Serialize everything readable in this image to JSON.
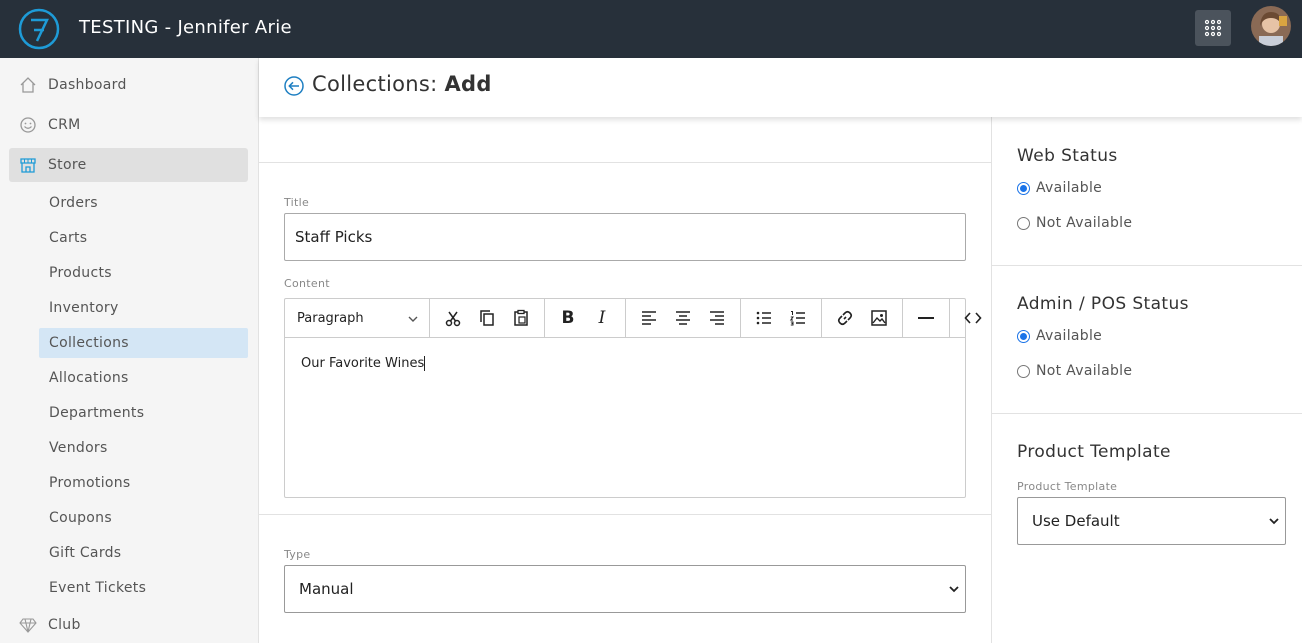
{
  "app": {
    "title": "TESTING - Jennifer Arie"
  },
  "sidebar": {
    "top_items": [
      {
        "label": "Dashboard",
        "icon": "home-icon"
      },
      {
        "label": "CRM",
        "icon": "smiley-icon"
      },
      {
        "label": "Store",
        "icon": "store-icon",
        "active": true
      }
    ],
    "store_items": [
      {
        "label": "Orders"
      },
      {
        "label": "Carts"
      },
      {
        "label": "Products"
      },
      {
        "label": "Inventory"
      },
      {
        "label": "Collections",
        "active": true
      },
      {
        "label": "Allocations"
      },
      {
        "label": "Departments"
      },
      {
        "label": "Vendors"
      },
      {
        "label": "Promotions"
      },
      {
        "label": "Coupons"
      },
      {
        "label": "Gift Cards"
      },
      {
        "label": "Event Tickets"
      }
    ],
    "bottom_items": [
      {
        "label": "Club",
        "icon": "diamond-icon"
      }
    ]
  },
  "header": {
    "title_prefix": "Collections:",
    "title_action": "Add"
  },
  "form": {
    "title_label": "Title",
    "title_value": "Staff Picks",
    "content_label": "Content",
    "editor": {
      "block_format": "Paragraph",
      "tools": [
        "cut-icon",
        "copy-icon",
        "paste-icon",
        "bold-icon",
        "italic-icon",
        "align-left-icon",
        "align-center-icon",
        "align-right-icon",
        "bullet-list-icon",
        "numbered-list-icon",
        "link-icon",
        "image-icon",
        "horizontal-rule-icon",
        "code-icon"
      ],
      "content": "Our Favorite Wines"
    },
    "type_label": "Type",
    "type_value": "Manual"
  },
  "web_status": {
    "title": "Web Status",
    "options": [
      {
        "label": "Available",
        "checked": true
      },
      {
        "label": "Not Available",
        "checked": false
      }
    ]
  },
  "admin_status": {
    "title": "Admin / POS Status",
    "options": [
      {
        "label": "Available",
        "checked": true
      },
      {
        "label": "Not Available",
        "checked": false
      }
    ]
  },
  "product_template": {
    "title": "Product Template",
    "label": "Product Template",
    "value": "Use Default"
  },
  "colors": {
    "topbar": "#27303a",
    "accent": "#1a73e8",
    "active_nav": "#d4e6f5",
    "logo": "#1e9bd7"
  }
}
